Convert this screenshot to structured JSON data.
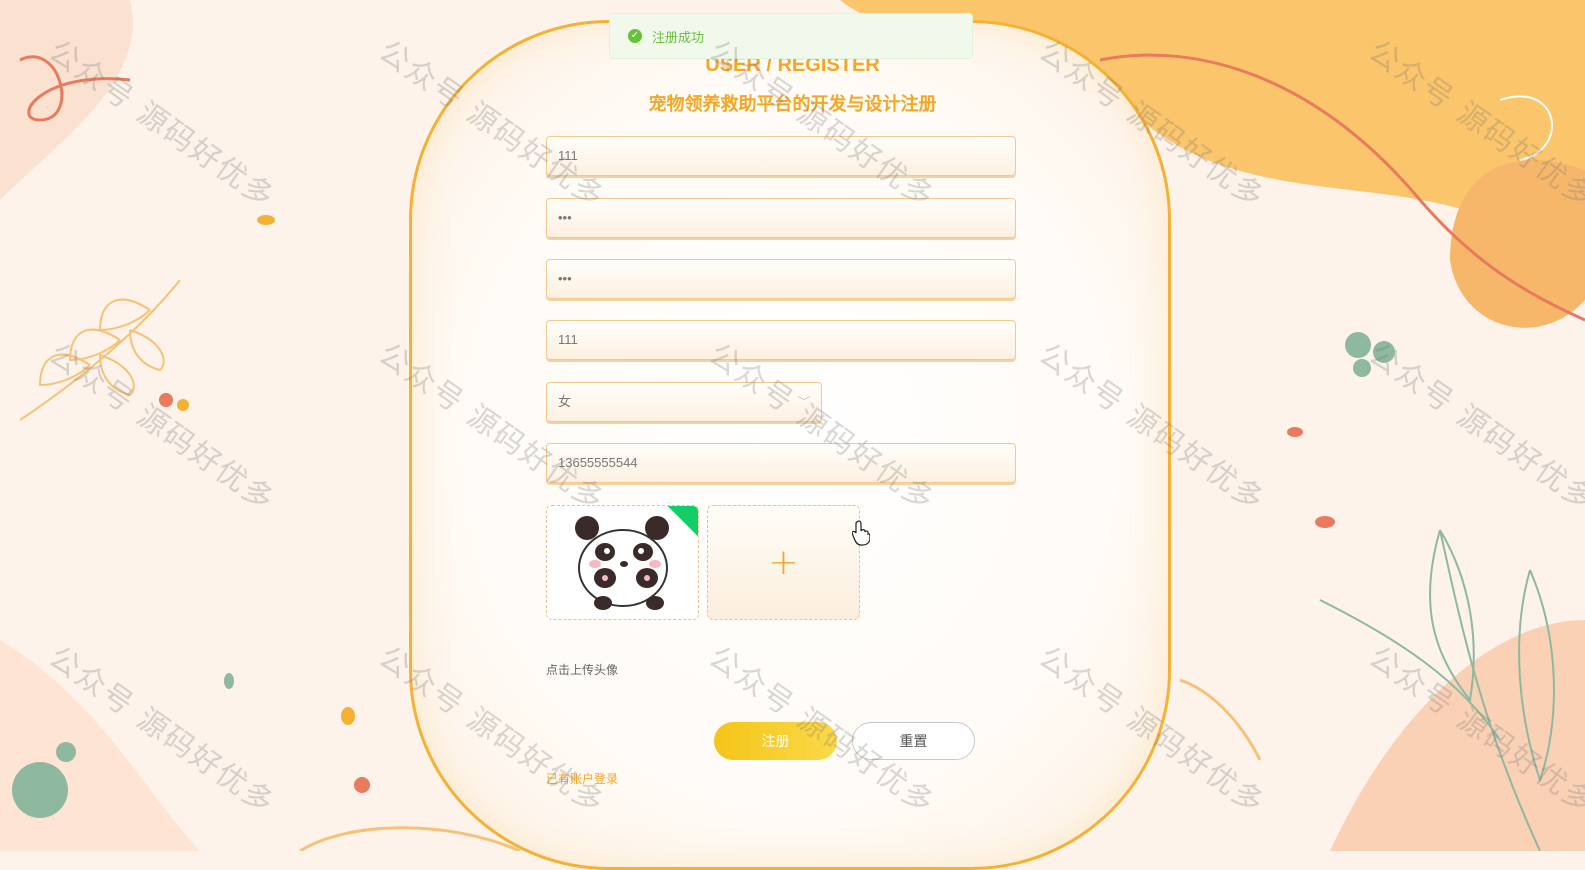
{
  "toast": {
    "message": "注册成功"
  },
  "header": {
    "title_en": "USER / REGISTER",
    "title_cn": "宠物领养救助平台的开发与设计注册"
  },
  "form": {
    "username": "111",
    "password": "•••",
    "confirm_password": "•••",
    "name": "111",
    "gender": "女",
    "phone": "13655555544"
  },
  "upload": {
    "tip": "点击上传头像",
    "add_symbol": "+"
  },
  "buttons": {
    "register": "注册",
    "reset": "重置"
  },
  "login_link": "已有账户登录",
  "watermark": "公众号 源码好优多",
  "colors": {
    "accent": "#f5a623",
    "success": "#67c23a"
  }
}
